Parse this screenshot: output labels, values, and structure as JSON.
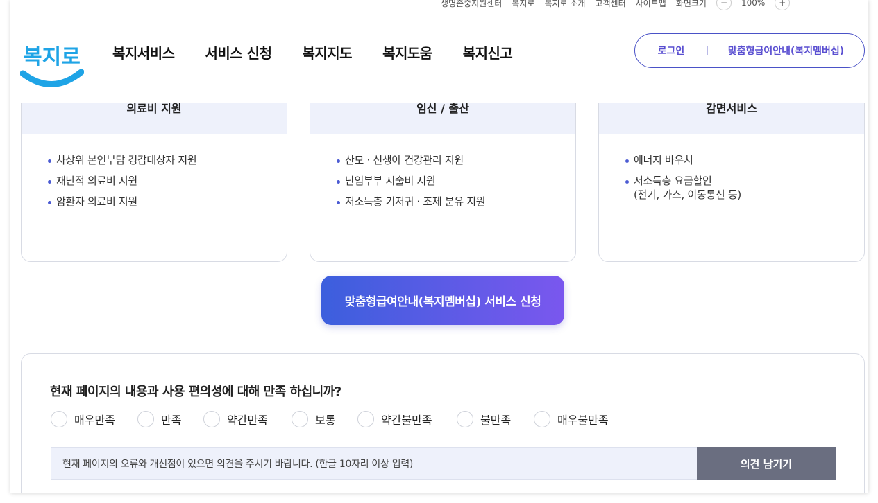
{
  "utility": {
    "items": [
      "생명존중지원센터",
      "복지로",
      "복지로 소개",
      "고객센터",
      "사이트맵",
      "화면크기"
    ],
    "zoom_minus": "−",
    "zoom_value": "100%",
    "zoom_plus": "+"
  },
  "header": {
    "logo_text": "복지로",
    "nav": [
      "복지서비스",
      "서비스 신청",
      "복지지도",
      "복지도움",
      "복지신고"
    ],
    "login_label": "로그인",
    "member_label": "맞춤형급여안내(복지멤버십)"
  },
  "cards": [
    {
      "title": "의료비 지원",
      "items": [
        "차상위 본인부담 경감대상자 지원",
        "재난적 의료비 지원",
        "암환자 의료비 지원"
      ]
    },
    {
      "title": "임신 / 출산",
      "items": [
        "산모 · 신생아 건강관리 지원",
        "난임부부 시술비 지원",
        "저소득층 기저귀 · 조제 분유 지원"
      ]
    },
    {
      "title": "감면서비스",
      "items": [
        "에너지 바우처",
        "저소득층 요금할인",
        "(전기, 가스, 이동통신 등)"
      ]
    }
  ],
  "cta_label": "맞춤형급여안내(복지멤버십) 서비스 신청",
  "survey": {
    "question": "현재 페이지의 내용과 사용 편의성에 대해 만족 하십니까?",
    "options": [
      "매우만족",
      "만족",
      "약간만족",
      "보통",
      "약간불만족",
      "불만족",
      "매우불만족"
    ],
    "feedback_placeholder": "현재 페이지의 오류와 개선점이 있으면 의견을 주시기 바랍니다. (한글 10자리 이상 입력)",
    "submit_label": "의견 남기기"
  },
  "colors": {
    "accent": "#4a52c7",
    "cta_start": "#3c5fdd",
    "cta_end": "#7a57ee",
    "logo_blue": "#1fa4e6"
  }
}
